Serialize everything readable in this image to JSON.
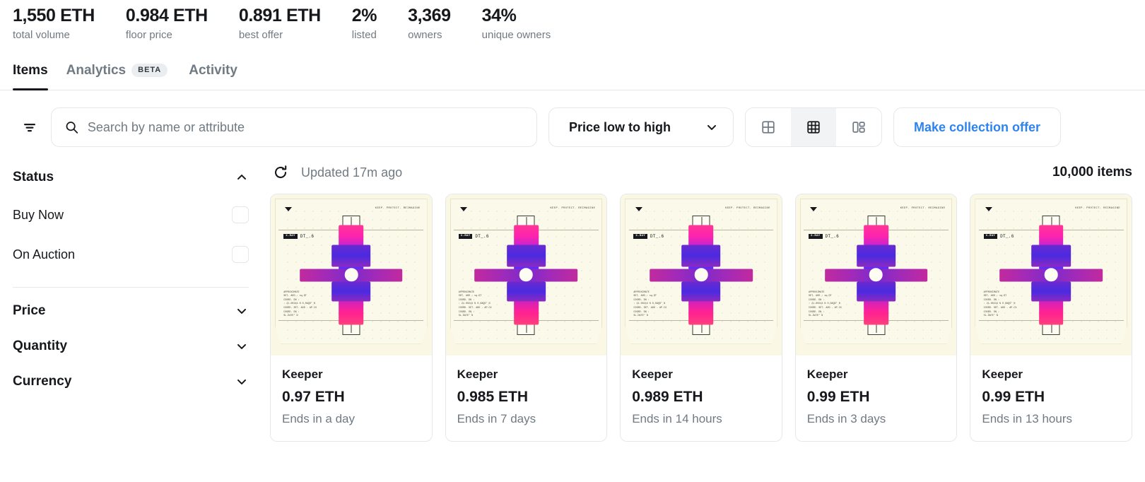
{
  "stats": [
    {
      "value": "1,550 ETH",
      "label": "total volume"
    },
    {
      "value": "0.984 ETH",
      "label": "floor price"
    },
    {
      "value": "0.891 ETH",
      "label": "best offer"
    },
    {
      "value": "2%",
      "label": "listed"
    },
    {
      "value": "3,369",
      "label": "owners"
    },
    {
      "value": "34%",
      "label": "unique owners"
    }
  ],
  "tabs": [
    {
      "label": "Items",
      "badge": "",
      "active": true
    },
    {
      "label": "Analytics",
      "badge": "BETA",
      "active": false
    },
    {
      "label": "Activity",
      "badge": "",
      "active": false
    }
  ],
  "toolbar": {
    "filter_icon": "filter-icon",
    "search_placeholder": "Search by name or attribute",
    "search_value": "",
    "search_icon": "search-icon",
    "sort_label": "Price low to high",
    "sort_chevron_icon": "chevron-down-icon",
    "views": [
      {
        "icon": "grid-2x2-icon",
        "active": false
      },
      {
        "icon": "grid-3x3-icon",
        "active": true
      },
      {
        "icon": "list-detail-icon",
        "active": false
      }
    ],
    "offer_label": "Make collection offer"
  },
  "sidebar": {
    "sections": [
      {
        "title": "Status",
        "expanded": true,
        "chevron_icon": "chevron-up-icon"
      },
      {
        "title": "Price",
        "expanded": false,
        "chevron_icon": "chevron-down-icon"
      },
      {
        "title": "Quantity",
        "expanded": false,
        "chevron_icon": "chevron-down-icon"
      },
      {
        "title": "Currency",
        "expanded": false,
        "chevron_icon": "chevron-down-icon"
      }
    ],
    "status_options": [
      {
        "label": "Buy Now",
        "checked": false
      },
      {
        "label": "On Auction",
        "checked": false
      }
    ]
  },
  "results": {
    "refresh_icon": "refresh-icon",
    "updated_text": "Updated 17m ago",
    "item_count": "10,000 items"
  },
  "artwork": {
    "tagline": "KEEP. PROTECT. REIMAGINE",
    "badge_pill": "X-RAY",
    "badge_code": "DT_.6",
    "specs": "APPROXIMATE\nSET. ADD : sq.DT\nCOORD. DN :\n: 21.00244 N 0.0AQS° N\nCOORD. SET. ADD - AP.CX\nCOORD. DN :\nSL.DATE° N",
    "caret_icon": "caret-down-icon"
  },
  "items": [
    {
      "name": "Keeper",
      "price": "0.97 ETH",
      "ends": "Ends in a day"
    },
    {
      "name": "Keeper",
      "price": "0.985 ETH",
      "ends": "Ends in 7 days"
    },
    {
      "name": "Keeper",
      "price": "0.989 ETH",
      "ends": "Ends in 14 hours"
    },
    {
      "name": "Keeper",
      "price": "0.99 ETH",
      "ends": "Ends in 3 days"
    },
    {
      "name": "Keeper",
      "price": "0.99 ETH",
      "ends": "Ends in 13 hours"
    }
  ],
  "colors": {
    "accent_blue": "#2e83ef",
    "text_primary": "#16181c",
    "text_muted": "#707a83",
    "border": "#e5e8eb",
    "art_background": "#faf8e5"
  }
}
